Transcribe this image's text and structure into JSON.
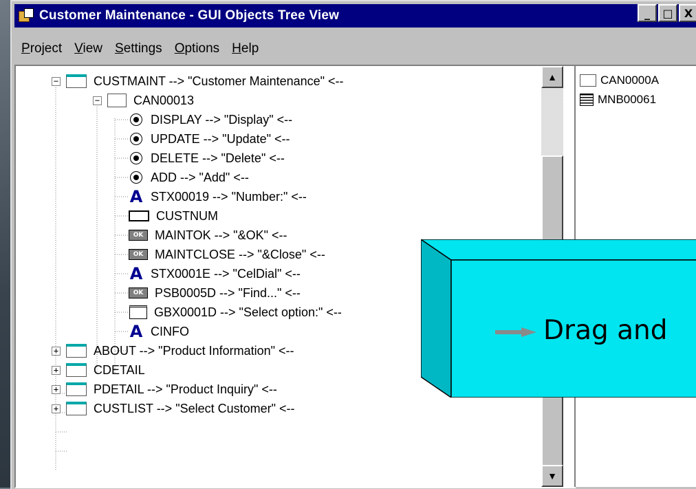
{
  "window": {
    "title": "Customer Maintenance - GUI Objects Tree View",
    "buttons": {
      "minimize": "_",
      "maximize": "□",
      "close": "X"
    }
  },
  "menu": [
    "Project",
    "View",
    "Settings",
    "Options",
    "Help"
  ],
  "tree": [
    {
      "label": "CUSTMAINT --> \"Customer Maintenance\" <--",
      "icon": "window-icon",
      "expander": "−"
    },
    {
      "label": "CAN00013",
      "icon": "container-icon",
      "expander": "−"
    },
    {
      "label": "DISPLAY --> \"Display\" <--",
      "icon": "radio-button-icon"
    },
    {
      "label": "UPDATE --> \"Update\" <--",
      "icon": "radio-button-icon"
    },
    {
      "label": "DELETE --> \"Delete\" <--",
      "icon": "radio-button-icon"
    },
    {
      "label": "ADD --> \"Add\" <--",
      "icon": "radio-button-icon"
    },
    {
      "label": "STX00019 --> \"Number:\" <--",
      "icon": "static-text-icon"
    },
    {
      "label": "CUSTNUM",
      "icon": "edit-field-icon"
    },
    {
      "label": "MAINTOK --> \"&OK\" <--",
      "icon": "push-button-icon"
    },
    {
      "label": "MAINTCLOSE --> \"&Close\" <--",
      "icon": "push-button-icon"
    },
    {
      "label": "STX0001E --> \"CelDial\" <--",
      "icon": "static-text-icon"
    },
    {
      "label": "PSB0005D --> \"Find...\" <--",
      "icon": "push-button-icon"
    },
    {
      "label": "GBX0001D --> \"Select option:\" <--",
      "icon": "group-box-icon"
    },
    {
      "label": "CINFO",
      "icon": "static-text-icon"
    },
    {
      "label": "ABOUT --> \"Product Information\" <--",
      "icon": "window-icon",
      "expander": "+"
    },
    {
      "label": "CDETAIL",
      "icon": "window-icon",
      "expander": "+"
    },
    {
      "label": "PDETAIL --> \"Product Inquiry\" <--",
      "icon": "window-icon",
      "expander": "+"
    },
    {
      "label": "CUSTLIST --> \"Select Customer\" <--",
      "icon": "window-icon",
      "expander": "+"
    }
  ],
  "list": [
    {
      "label": "CAN0000A",
      "icon": "container-icon"
    },
    {
      "label": "MNB00061",
      "icon": "menu-bar-icon"
    }
  ],
  "icon_glyphs": {
    "text": "A",
    "ok": "OK"
  },
  "scroll": {
    "up": "▲",
    "down": "▼"
  },
  "callout": {
    "text": "Drag and",
    "arrow_icon": "right-arrow-icon",
    "face_color": "#00e5ef",
    "side_color": "#00b8c4"
  }
}
